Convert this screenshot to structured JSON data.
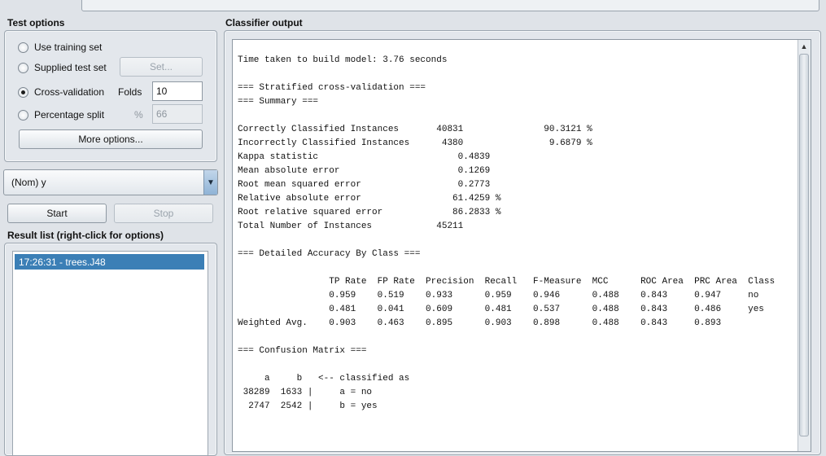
{
  "test_options": {
    "title": "Test options",
    "use_training_set": "Use training set",
    "supplied_test_set": "Supplied test set",
    "set_button": "Set...",
    "cross_validation": "Cross-validation",
    "folds_label": "Folds",
    "folds_value": "10",
    "percentage_split": "Percentage split",
    "percent_sign": "%",
    "percentage_value": "66",
    "more_options": "More options...",
    "selected": "cross_validation"
  },
  "class_selector": {
    "value": "(Nom) y"
  },
  "controls": {
    "start": "Start",
    "stop": "Stop"
  },
  "result_list": {
    "title": "Result list (right-click for options)",
    "items": [
      "17:26:31 - trees.J48"
    ]
  },
  "classifier_output": {
    "title": "Classifier output",
    "text": "Time taken to build model: 3.76 seconds\n\n=== Stratified cross-validation ===\n=== Summary ===\n\nCorrectly Classified Instances       40831               90.3121 %\nIncorrectly Classified Instances      4380                9.6879 %\nKappa statistic                          0.4839\nMean absolute error                      0.1269\nRoot mean squared error                  0.2773\nRelative absolute error                 61.4259 %\nRoot relative squared error             86.2833 %\nTotal Number of Instances            45211     \n\n=== Detailed Accuracy By Class ===\n\n                 TP Rate  FP Rate  Precision  Recall   F-Measure  MCC      ROC Area  PRC Area  Class\n                 0.959    0.519    0.933      0.959    0.946      0.488    0.843     0.947     no\n                 0.481    0.041    0.609      0.481    0.537      0.488    0.843     0.486     yes\nWeighted Avg.    0.903    0.463    0.895      0.903    0.898      0.488    0.843     0.893     \n\n=== Confusion Matrix ===\n\n     a     b   <-- classified as\n 38289  1633 |     a = no\n  2747  2542 |     b = yes"
  },
  "colors": {
    "selection": "#3b7fb6",
    "background": "#dfe3e8"
  }
}
